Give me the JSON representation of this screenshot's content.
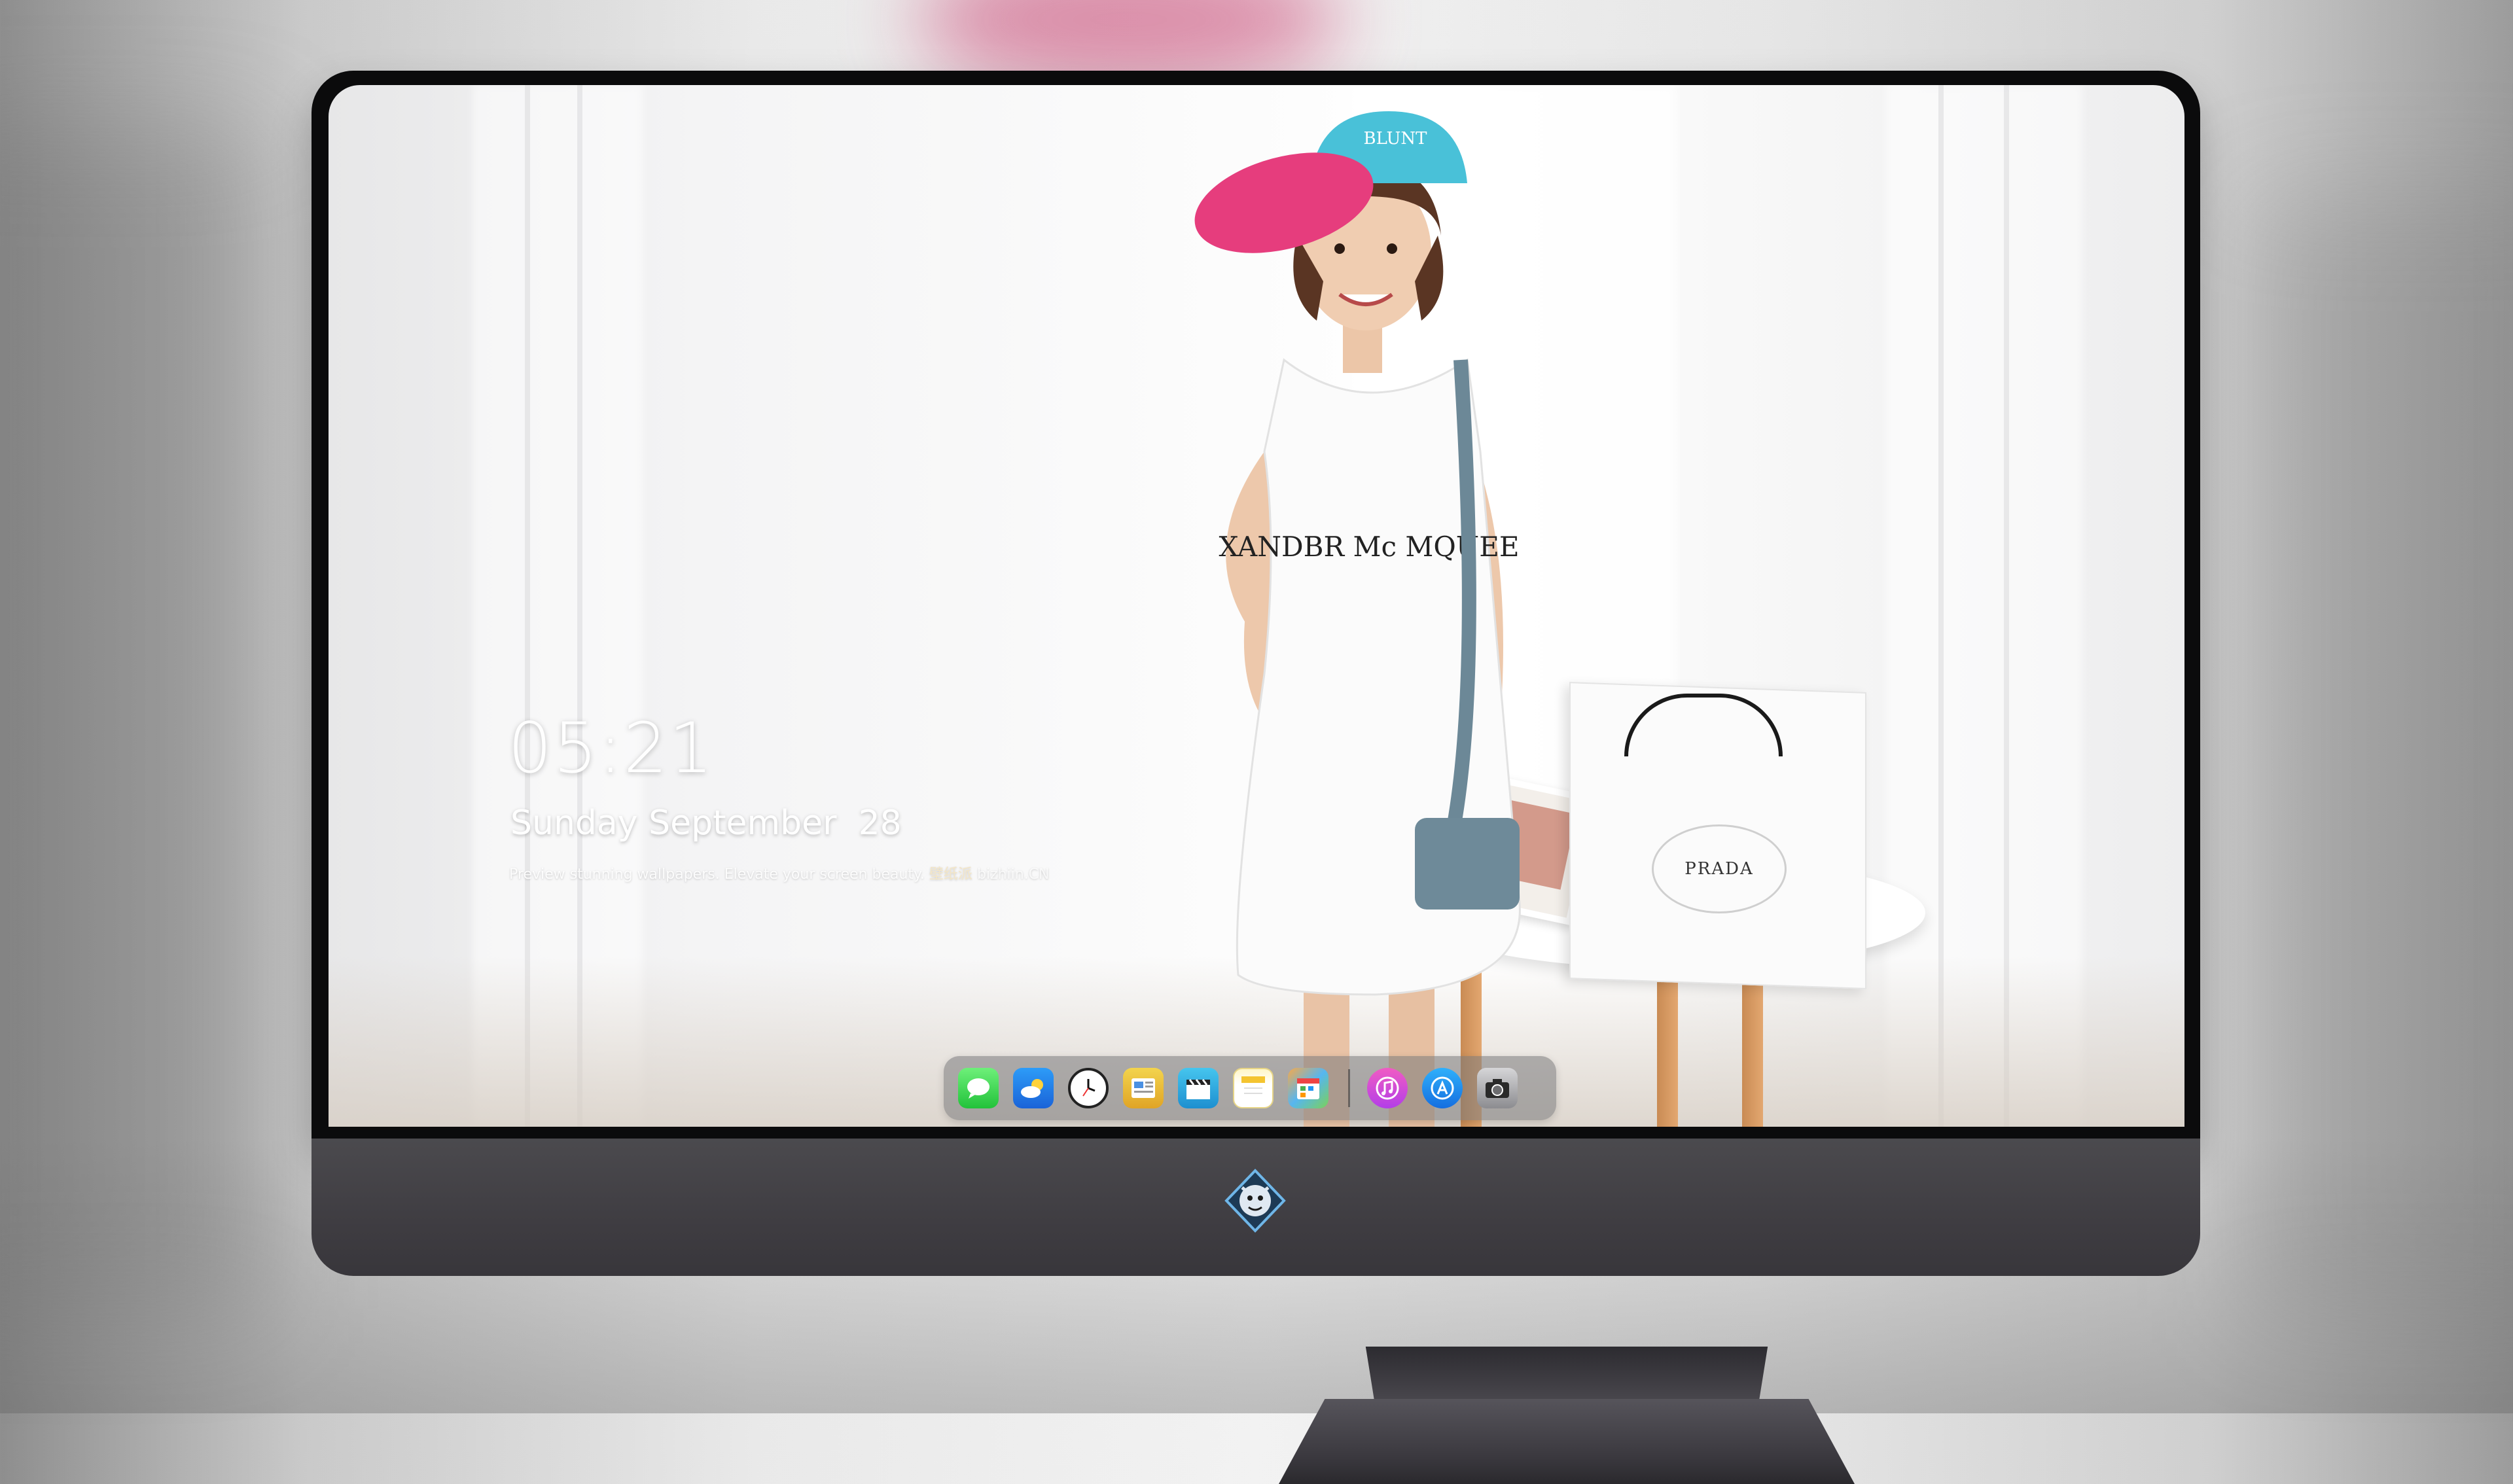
{
  "lock_screen": {
    "time": "05:21",
    "date": "Sunday September  28",
    "tagline": "Preview stunning wallpapers. Elevate your screen beauty.",
    "tagline_brand": "壁纸派",
    "tagline_site": "bizhiin.CN"
  },
  "wallpaper": {
    "cap_text": "BLUNT",
    "shirt_text": "XANDBR  Mc  MQUEE",
    "bag_brand": "PRADA"
  },
  "dock": {
    "apps": [
      {
        "name": "messages",
        "icon": "message-bubble-icon"
      },
      {
        "name": "weather",
        "icon": "cloud-sun-icon"
      },
      {
        "name": "clock",
        "icon": "clock-icon"
      },
      {
        "name": "news",
        "icon": "newspaper-icon"
      },
      {
        "name": "video",
        "icon": "clapperboard-icon"
      },
      {
        "name": "notes",
        "icon": "notes-icon"
      },
      {
        "name": "calendar",
        "icon": "calendar-icon"
      },
      {
        "name": "itunes",
        "icon": "music-note-icon"
      },
      {
        "name": "app-store",
        "icon": "app-store-icon"
      },
      {
        "name": "camera",
        "icon": "camera-icon"
      }
    ]
  },
  "colors": {
    "bezel": "#0b0b0c",
    "chin": "#403e44",
    "dock_bg": "rgba(120,120,122,0.55)",
    "text": "#ffffff"
  }
}
